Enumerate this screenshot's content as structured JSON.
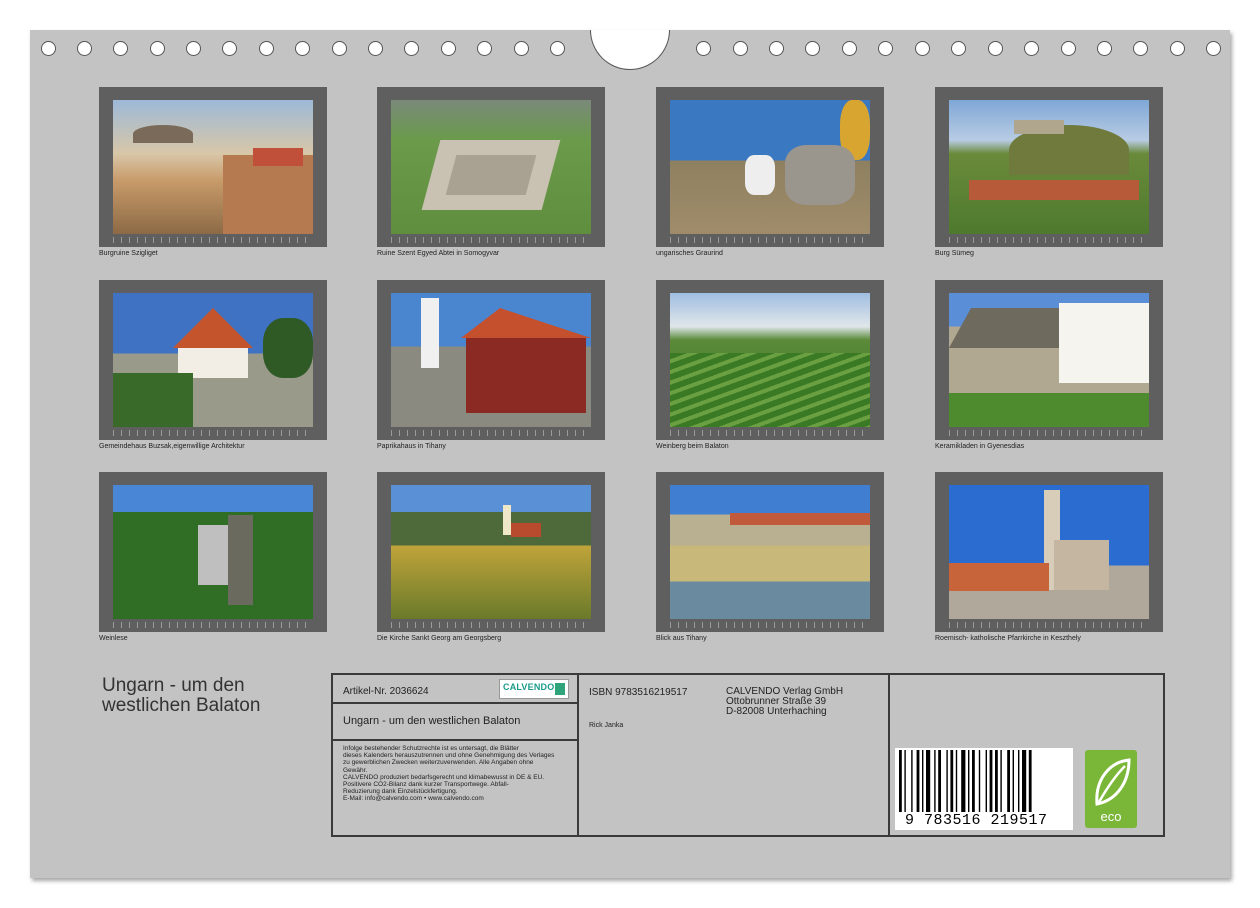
{
  "calendar_title_lines": [
    "Ungarn - um den",
    "westlichen Balaton"
  ],
  "photos": [
    {
      "caption": "Burgruine Szigliget",
      "icon": "castle-ruin-photo"
    },
    {
      "caption": "Ruine Szent Egyed Abtei in Somogyvar",
      "icon": "abbey-ruin-photo"
    },
    {
      "caption": "ungarisches Graurind",
      "icon": "grey-cattle-photo"
    },
    {
      "caption": "Burg Sümeg",
      "icon": "hill-castle-photo"
    },
    {
      "caption": "Gemeindehaus Buzsak,eigenwillige Architektur",
      "icon": "village-house-photo"
    },
    {
      "caption": "Paprikahaus in Tihany",
      "icon": "paprika-house-photo"
    },
    {
      "caption": "Weinberg beim Balaton",
      "icon": "vineyard-photo"
    },
    {
      "caption": "Keramikladen in Gyenesdias",
      "icon": "ceramics-shop-photo"
    },
    {
      "caption": "Weinlese",
      "icon": "grape-harvest-photo"
    },
    {
      "caption": "Die Kirche Sankt Georg am Georgsberg",
      "icon": "hill-church-photo"
    },
    {
      "caption": "Blick aus Tihany",
      "icon": "lake-view-photo"
    },
    {
      "caption": "Roemisch- katholische Pfarrkirche in Keszthely",
      "icon": "cathedral-photo"
    }
  ],
  "info": {
    "article": "Artikel-Nr. 2036624",
    "logo_text": "CALVENDO",
    "title": "Ungarn - um den westlichen Balaton",
    "isbn": "ISBN 9783516219517",
    "publisher_lines": [
      "CALVENDO Verlag GmbH",
      "Ottobrunner Straße 39",
      "D-82008 Unterhaching"
    ],
    "author": "Rick Janka",
    "legal_lines": [
      "Infolge bestehender Schutzrechte ist es untersagt, die Blätter",
      "dieses Kalenders herauszutrennen und ohne Genehmigung des Verlages",
      "zu gewerblichen Zwecken weiterzuverwenden. Alle Angaben ohne",
      "Gewähr.",
      "CALVENDO produziert bedarfsgerecht und klimabewusst in DE & EU.",
      "Positivere CO2-Bilanz dank kurzer Transportwege. Abfall-",
      "Reduzierung dank Einzelstückfertigung.",
      "E-Mail: info@calvendo.com • www.calvendo.com"
    ],
    "barcode_number": "9 783516 219517",
    "eco_label": "eco"
  }
}
